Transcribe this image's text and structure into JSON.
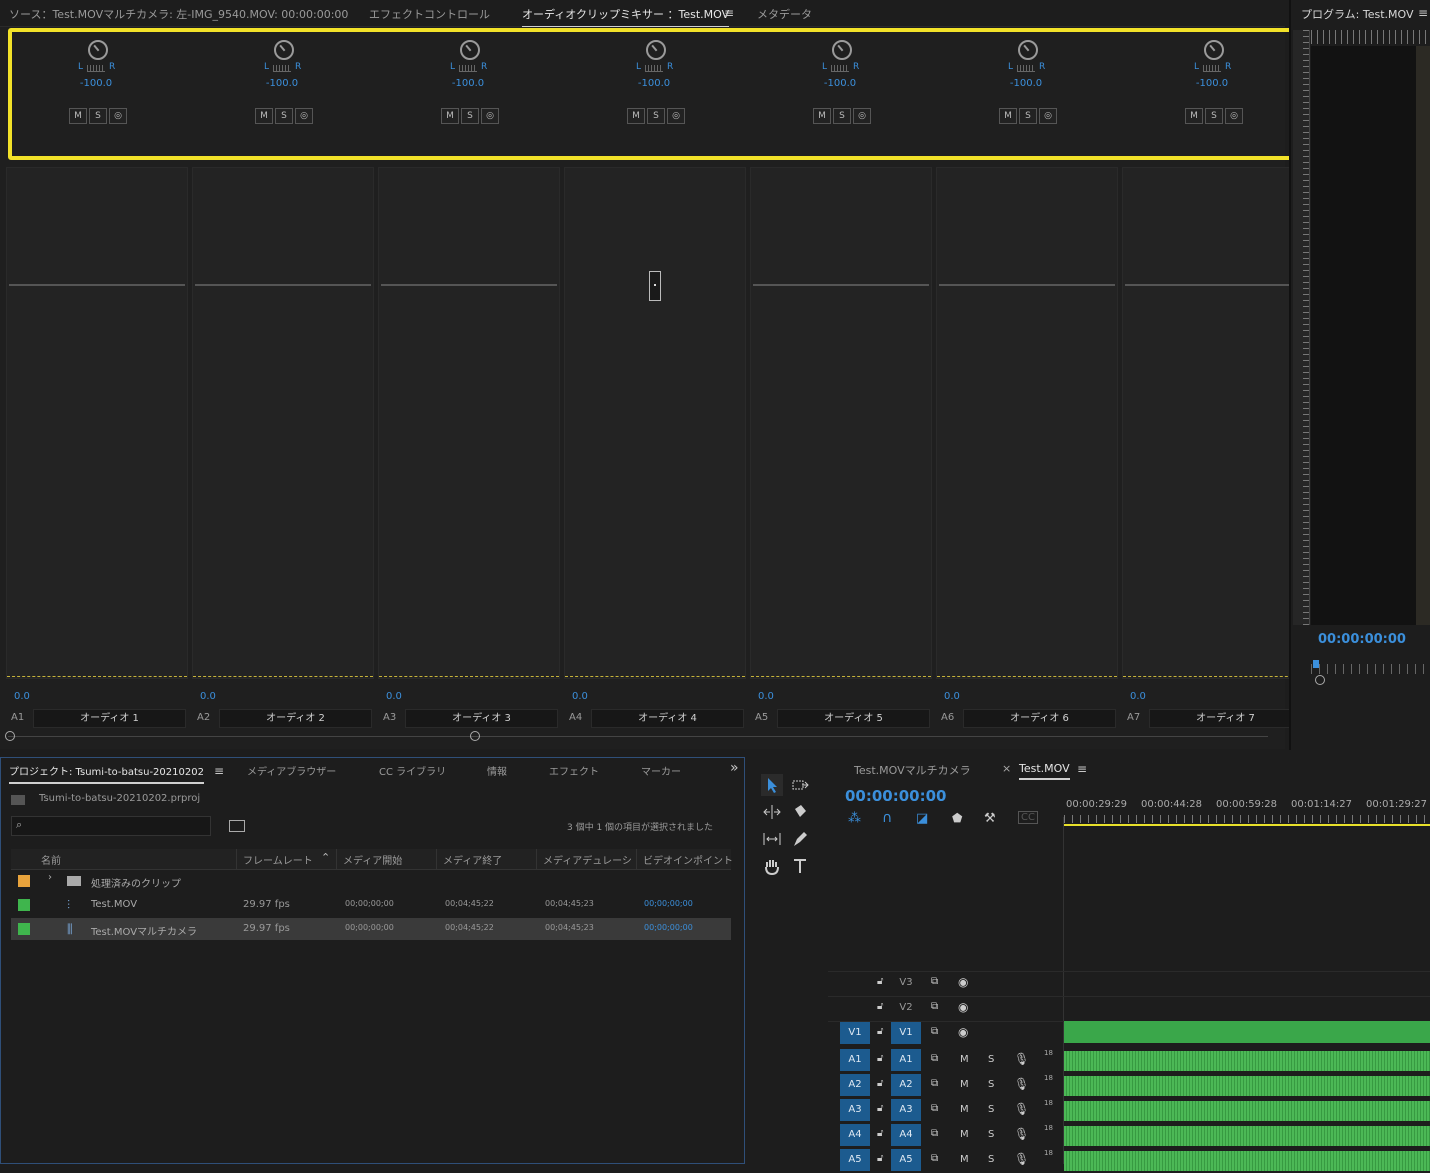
{
  "top_tabs": {
    "source": "ソース：Test.MOVマルチカメラ: 左-IMG_9540.MOV: 00:00:00:00",
    "effect_controls": "エフェクトコントロール",
    "audio_clip_mixer": "オーディオクリップミキサー ：Test.MOV",
    "metadata": "メタデータ",
    "menu": "≡"
  },
  "mixer": {
    "channels": [
      {
        "id": "A1",
        "name": "オーディオ 1",
        "pan": "-100.0",
        "volume": "0.0",
        "l": "L",
        "r": "R",
        "m": "M",
        "s": "S",
        "v": "◎"
      },
      {
        "id": "A2",
        "name": "オーディオ 2",
        "pan": "-100.0",
        "volume": "0.0",
        "l": "L",
        "r": "R",
        "m": "M",
        "s": "S",
        "v": "◎"
      },
      {
        "id": "A3",
        "name": "オーディオ 3",
        "pan": "-100.0",
        "volume": "0.0",
        "l": "L",
        "r": "R",
        "m": "M",
        "s": "S",
        "v": "◎"
      },
      {
        "id": "A4",
        "name": "オーディオ 4",
        "pan": "-100.0",
        "volume": "0.0",
        "l": "L",
        "r": "R",
        "m": "M",
        "s": "S",
        "v": "◎"
      },
      {
        "id": "A5",
        "name": "オーディオ 5",
        "pan": "-100.0",
        "volume": "0.0",
        "l": "L",
        "r": "R",
        "m": "M",
        "s": "S",
        "v": "◎"
      },
      {
        "id": "A6",
        "name": "オーディオ 6",
        "pan": "-100.0",
        "volume": "0.0",
        "l": "L",
        "r": "R",
        "m": "M",
        "s": "S",
        "v": "◎"
      },
      {
        "id": "A7",
        "name": "オーディオ 7",
        "pan": "-100.0",
        "volume": "0.0",
        "l": "L",
        "r": "R",
        "m": "M",
        "s": "S",
        "v": "◎"
      }
    ]
  },
  "program": {
    "title": "プログラム: Test.MOV",
    "menu": "≡",
    "timecode": "00:00:00:00"
  },
  "project": {
    "tabs": [
      "プロジェクト: Tsumi-to-batsu-20210202",
      "メディアブラウザー",
      "CC ライブラリ",
      "情報",
      "エフェクト",
      "マーカー"
    ],
    "menu": "≡",
    "more": "»",
    "file": "Tsumi-to-batsu-20210202.prproj",
    "selection_status": "3 個中 1 個の項目が選択されました",
    "columns": [
      "名前",
      "フレームレート",
      "メディア開始",
      "メディア終了",
      "メディアデュレーシ",
      "ビデオインポイント"
    ],
    "rows": [
      {
        "name": "処理済みのクリップ",
        "fps": "",
        "start": "",
        "end": "",
        "dur": "",
        "in": "",
        "color": "#e8a33c"
      },
      {
        "name": "Test.MOV",
        "fps": "29.97 fps",
        "start": "00;00;00;00",
        "end": "00;04;45;22",
        "dur": "00;04;45;23",
        "in": "00;00;00;00",
        "color": "#3fb54d"
      },
      {
        "name": "Test.MOVマルチカメラ",
        "fps": "29.97 fps",
        "start": "00;00;00;00",
        "end": "00;04;45;22",
        "dur": "00;04;45;23",
        "in": "00;00;00;00",
        "color": "#3fb54d"
      }
    ]
  },
  "timeline": {
    "tabs": [
      "Test.MOVマルチカメラ",
      "Test.MOV"
    ],
    "close": "×",
    "menu": "≡",
    "timecode": "00:00:00:00",
    "ruler": [
      "00:00:29:29",
      "00:00:44:28",
      "00:00:59:28",
      "00:01:14:27",
      "00:01:29:27"
    ],
    "video_tracks": [
      "V3",
      "V2",
      "V1"
    ],
    "audio_tracks": [
      "A1",
      "A2",
      "A3",
      "A4",
      "A5"
    ],
    "track_m": "M",
    "track_s": "S",
    "level": "18"
  }
}
